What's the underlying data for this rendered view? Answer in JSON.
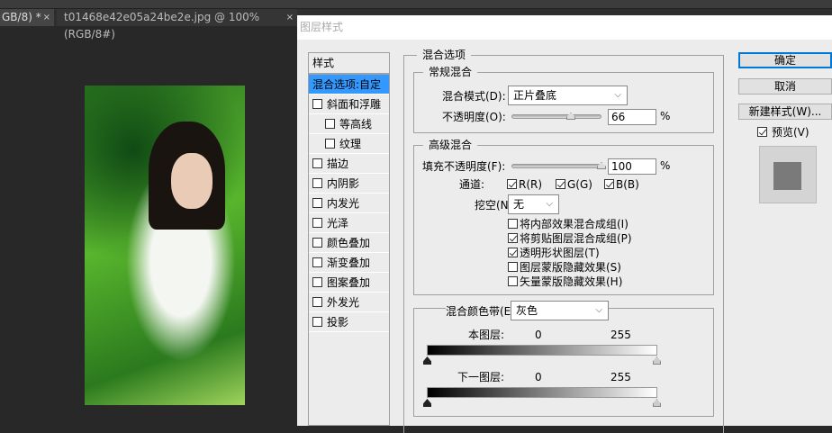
{
  "tabs": [
    {
      "label": "GB/8) *",
      "close": "×"
    },
    {
      "label": "t01468e42e05a24be2e.jpg @ 100%(RGB/8#)",
      "close": "×"
    }
  ],
  "dialog": {
    "title": "图层样式",
    "styles_header": "样式",
    "styles": [
      {
        "label": "混合选项:自定",
        "selected": true
      },
      {
        "label": "斜面和浮雕",
        "checked": false
      },
      {
        "label": "等高线",
        "checked": false,
        "indent": true
      },
      {
        "label": "纹理",
        "checked": false,
        "indent": true
      },
      {
        "label": "描边",
        "checked": false
      },
      {
        "label": "内阴影",
        "checked": false
      },
      {
        "label": "内发光",
        "checked": false
      },
      {
        "label": "光泽",
        "checked": false
      },
      {
        "label": "颜色叠加",
        "checked": false
      },
      {
        "label": "渐变叠加",
        "checked": false
      },
      {
        "label": "图案叠加",
        "checked": false
      },
      {
        "label": "外发光",
        "checked": false
      },
      {
        "label": "投影",
        "checked": false
      }
    ],
    "blend_options": {
      "title": "混合选项",
      "general": {
        "title": "常规混合",
        "mode_label": "混合模式(D):",
        "mode_value": "正片叠底",
        "opacity_label": "不透明度(O):",
        "opacity_value": "66",
        "opacity_percent": 66,
        "percent": "%"
      },
      "advanced": {
        "title": "高级混合",
        "fill_label": "填充不透明度(F):",
        "fill_value": "100",
        "fill_percent": 100,
        "percent": "%",
        "channels_label": "通道:",
        "channels": [
          {
            "label": "R(R)",
            "checked": true
          },
          {
            "label": "G(G)",
            "checked": true
          },
          {
            "label": "B(B)",
            "checked": true
          }
        ],
        "knockout_label": "挖空(N):",
        "knockout_value": "无",
        "options": [
          {
            "label": "将内部效果混合成组(I)",
            "checked": false
          },
          {
            "label": "将剪贴图层混合成组(P)",
            "checked": true
          },
          {
            "label": "透明形状图层(T)",
            "checked": true
          },
          {
            "label": "图层蒙版隐藏效果(S)",
            "checked": false
          },
          {
            "label": "矢量蒙版隐藏效果(H)",
            "checked": false
          }
        ]
      },
      "blend_if": {
        "label": "混合颜色带(E):",
        "value": "灰色",
        "this_layer": "本图层:",
        "this_min": "0",
        "this_max": "255",
        "underlying": "下一图层:",
        "under_min": "0",
        "under_max": "255"
      }
    },
    "buttons": {
      "ok": "确定",
      "cancel": "取消",
      "new_style": "新建样式(W)...",
      "preview": "预览(V)",
      "preview_checked": true
    }
  }
}
